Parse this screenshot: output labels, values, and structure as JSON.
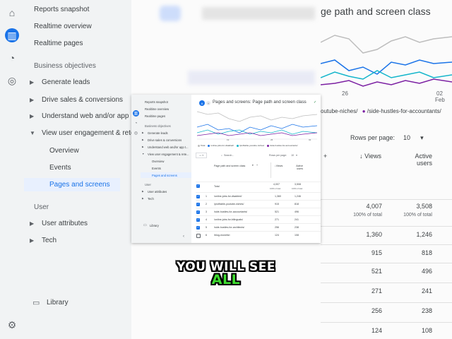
{
  "nav": {
    "items": [
      {
        "label": "Reports snapshot",
        "type": "item"
      },
      {
        "label": "Realtime overview",
        "type": "item"
      },
      {
        "label": "Realtime pages",
        "type": "item"
      },
      {
        "label": "Business objectives",
        "type": "section"
      },
      {
        "label": "Generate leads",
        "type": "child"
      },
      {
        "label": "Drive sales & conversions",
        "type": "child"
      },
      {
        "label": "Understand web and/or app traffic",
        "type": "child"
      },
      {
        "label": "View user engagement & retention",
        "type": "child-open"
      },
      {
        "label": "Overview",
        "type": "sub"
      },
      {
        "label": "Events",
        "type": "sub"
      },
      {
        "label": "Pages and screens",
        "type": "sub-selected"
      },
      {
        "label": "User",
        "type": "section"
      },
      {
        "label": "User attributes",
        "type": "child"
      },
      {
        "label": "Tech",
        "type": "child"
      }
    ],
    "library_label": "Library",
    "bg_labels": {
      "understand": "Understand web and/or app",
      "engagement": "View user engagement & rete"
    },
    "win_labels": {
      "understand": "Understand web and/or app t...",
      "engagement": "View user engagement & rete..."
    }
  },
  "rail_icons": [
    "home-icon",
    "reports-icon",
    "explore-icon",
    "advertising-icon"
  ],
  "settings_icon": "gear-icon",
  "header": {
    "title": "Pages and screens: Page path and screen class",
    "title_bg_fragment": "ge path and screen class",
    "avatar_letter": "A"
  },
  "chart_data": {
    "type": "line",
    "x_ticks": [
      "19",
      "26",
      "02"
    ],
    "x_subtick": "Feb",
    "legend": [
      {
        "name": "Total",
        "color": "#bdbdbd"
      },
      {
        "name": "/online-jobs-for-disabled/",
        "color": "#1a73e8"
      },
      {
        "name": "/profitable-youtube-niches/",
        "color": "#12b5cb"
      },
      {
        "name": "/side-hustles-for-accountants/",
        "color": "#7b1fa2"
      }
    ],
    "bg_legend_fragment": "outube-niches/",
    "bg_legend_second": "/side-hustles-for-accountants/"
  },
  "table": {
    "search_placeholder": "Search...",
    "rows_per_page_label": "Rows per page:",
    "rows_per_page_value": "10",
    "columns": {
      "dimension": "Page path and screen class",
      "views": "Views",
      "active_users": "Active users"
    },
    "total": {
      "label": "Total",
      "views": "4,007",
      "active": "3,508",
      "views_pct": "100% of total",
      "active_pct": "100% of total"
    },
    "rows": [
      {
        "n": "1",
        "page": "/online-jobs-for-disabled/",
        "views": "1,360",
        "active": "1,246",
        "checked": true
      },
      {
        "n": "2",
        "page": "/profitable-youtube-niches/",
        "views": "915",
        "active": "818",
        "checked": true
      },
      {
        "n": "3",
        "page": "/side-hustles-for-accountants/",
        "views": "521",
        "active": "496",
        "checked": true
      },
      {
        "n": "4",
        "page": "/online-jobs-for-bilinguals/",
        "views": "271",
        "active": "241",
        "checked": true
      },
      {
        "n": "5",
        "page": "/side-hustles-for-architects/",
        "views": "256",
        "active": "238",
        "checked": true
      },
      {
        "n": "6",
        "page": "/blog-monetizi",
        "views": "124",
        "active": "108",
        "checked": false
      }
    ]
  },
  "caption": {
    "line1": "YOU WILL SEE",
    "line2": "ALL"
  }
}
